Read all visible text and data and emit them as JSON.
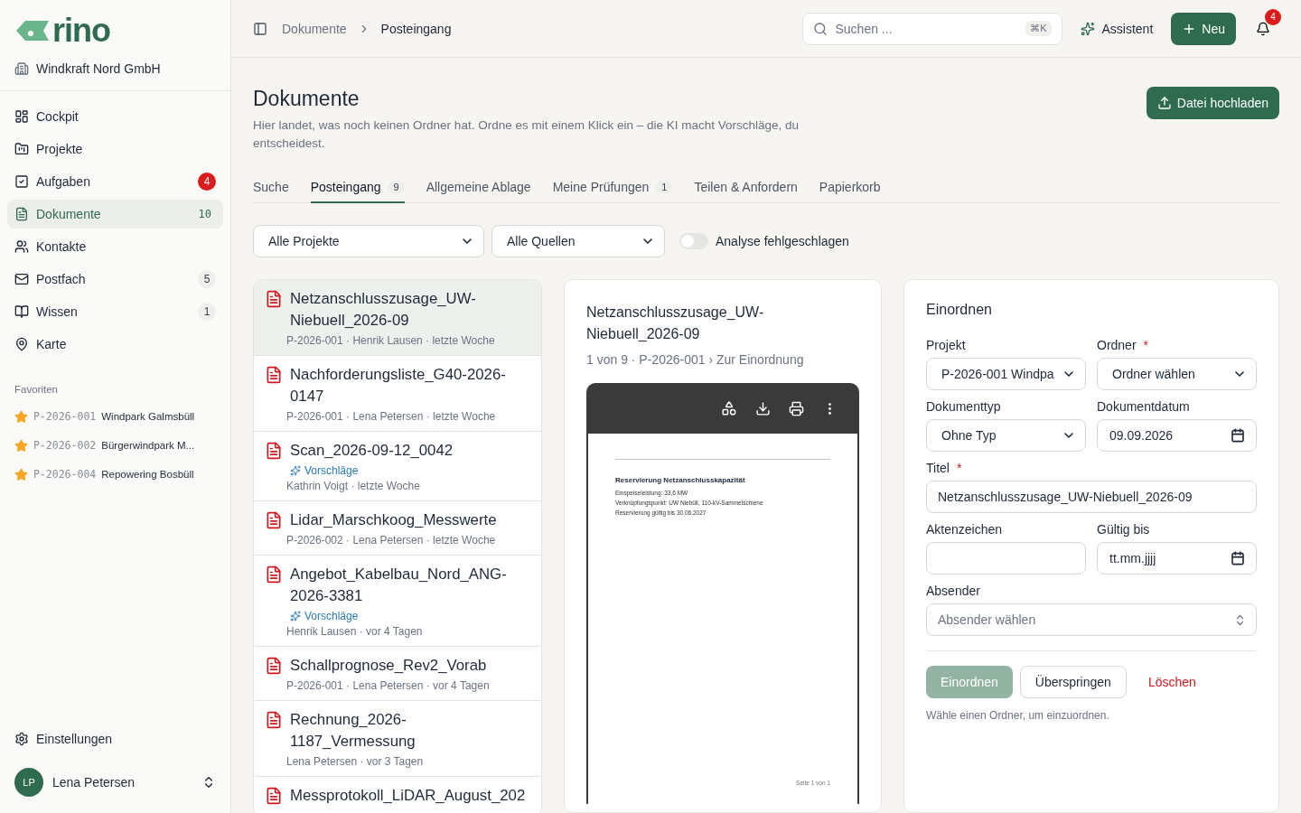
{
  "brand": {
    "logo": "rino"
  },
  "org": "Windkraft Nord GmbH",
  "nav": [
    {
      "label": "Cockpit",
      "selected": false
    },
    {
      "label": "Projekte",
      "selected": false
    },
    {
      "label": "Aufgaben",
      "badge": "4",
      "alert": true,
      "selected": false
    },
    {
      "label": "Dokumente",
      "badge": "10",
      "alert": false,
      "selected": true
    },
    {
      "label": "Kontakte",
      "selected": false
    },
    {
      "label": "Postfach",
      "badge": "5",
      "alert": false,
      "selected": false
    },
    {
      "label": "Wissen",
      "badge": "1",
      "alert": false,
      "selected": false
    },
    {
      "label": "Karte",
      "selected": false
    }
  ],
  "favorites": {
    "heading": "Favoriten",
    "items": [
      {
        "code": "P-2026-001",
        "name": "Windpark Galmsbüll"
      },
      {
        "code": "P-2026-002",
        "name": "Bürgerwindpark M..."
      },
      {
        "code": "P-2026-004",
        "name": "Repowering Bosbüll"
      }
    ]
  },
  "settings": "Einstellungen",
  "user": {
    "initials": "LP",
    "name": "Lena Petersen"
  },
  "breadcrumb": [
    "Dokumente",
    "Posteingang"
  ],
  "search": {
    "placeholder": "Suchen ...",
    "shortcut": "⌘K"
  },
  "assistant": "Assistent",
  "new_button": "Neu",
  "notifications": "4",
  "page": {
    "title": "Dokumente",
    "description": "Hier landet, was noch keinen Ordner hat. Ordne es mit einem Klick ein – die KI macht Vorschläge, du entscheidest.",
    "upload": "Datei hochladen"
  },
  "tabs": [
    {
      "label": "Suche",
      "selected": false
    },
    {
      "label": "Posteingang",
      "count": "9",
      "selected": true
    },
    {
      "label": "Allgemeine Ablage",
      "selected": false
    },
    {
      "label": "Meine Prüfungen",
      "count": "1",
      "selected": false
    },
    {
      "label": "Teilen & Anfordern",
      "selected": false
    },
    {
      "label": "Papierkorb",
      "selected": false
    }
  ],
  "filters": {
    "project": "Alle Projekte",
    "source": "Alle Quellen",
    "toggle": {
      "label": "Analyse fehlgeschlagen",
      "on": false
    }
  },
  "documents": [
    {
      "title": "Netzanschlusszusage_UW-Niebuell_2026-09",
      "meta": "P-2026-001 · Henrik Lausen · letzte Woche",
      "selected": true
    },
    {
      "title": "Nachforderungsliste_G40-2026-0147",
      "meta": "P-2026-001 · Lena Petersen · letzte Woche",
      "selected": false
    },
    {
      "title": "Scan_2026-09-12_0042",
      "suggestion": "Vorschläge",
      "meta": "Kathrin Voigt · letzte Woche",
      "selected": false
    },
    {
      "title": "Lidar_Marschkoog_Messwerte",
      "meta": "P-2026-002 · Lena Petersen · letzte Woche",
      "selected": false
    },
    {
      "title": "Angebot_Kabelbau_Nord_ANG-2026-3381",
      "suggestion": "Vorschläge",
      "meta": "Henrik Lausen · vor 4 Tagen",
      "selected": false
    },
    {
      "title": "Schallprognose_Rev2_Vorab",
      "meta": "P-2026-001 · Lena Petersen · vor 4 Tagen",
      "selected": false
    },
    {
      "title": "Rechnung_2026-1187_Vermessung",
      "meta": "Lena Petersen · vor 3 Tagen",
      "selected": false
    },
    {
      "title": "Messprotokoll_LiDAR_August_202",
      "selected": false
    }
  ],
  "preview": {
    "title": "Netzanschlusszusage_UW-Niebuell_2026-09",
    "subtitle": "1 von 9 · P-2026-001 › Zur Einordnung",
    "page_heading": "Reservierung Netzanschlusskapazität",
    "page_lines": [
      "Einspeiseleistung: 33,6 MW",
      "Verknüpfungspunkt: UW Niebüll, 110-kV-Sammelschiene",
      "Reservierung gültig bis 30.06.2027"
    ],
    "footer": "Seite 1 von 1"
  },
  "form": {
    "title": "Einordnen",
    "required_mark": "*",
    "rows": [
      [
        {
          "label": "Projekt",
          "kind": "select",
          "value": "P-2026-001 Windpa",
          "required": false
        },
        {
          "label": "Ordner",
          "kind": "select",
          "value": "Ordner wählen",
          "required": true
        }
      ],
      [
        {
          "label": "Dokumenttyp",
          "kind": "select",
          "value": "Ohne Typ",
          "required": false
        },
        {
          "label": "Dokumentdatum",
          "kind": "date",
          "value": "09.09.2026",
          "required": false
        }
      ],
      [
        {
          "label": "Titel",
          "kind": "text",
          "value": "Netzanschlusszusage_UW-Niebuell_2026-09",
          "required": true
        }
      ],
      [
        {
          "label": "Aktenzeichen",
          "kind": "text",
          "required": false
        },
        {
          "label": "Gültig bis",
          "kind": "date",
          "value": "tt.mm.jjjj",
          "required": false
        }
      ],
      [
        {
          "label": "Absender",
          "kind": "combobox",
          "placeholder": "Absender wählen",
          "required": false
        }
      ]
    ],
    "actions": [
      {
        "label": "Einordnen",
        "kind": "primary",
        "disabled": true
      },
      {
        "label": "Überspringen",
        "kind": "secondary"
      },
      {
        "label": "Löschen",
        "kind": "danger"
      }
    ],
    "hint": "Wähle einen Ordner, um einzuordnen."
  }
}
